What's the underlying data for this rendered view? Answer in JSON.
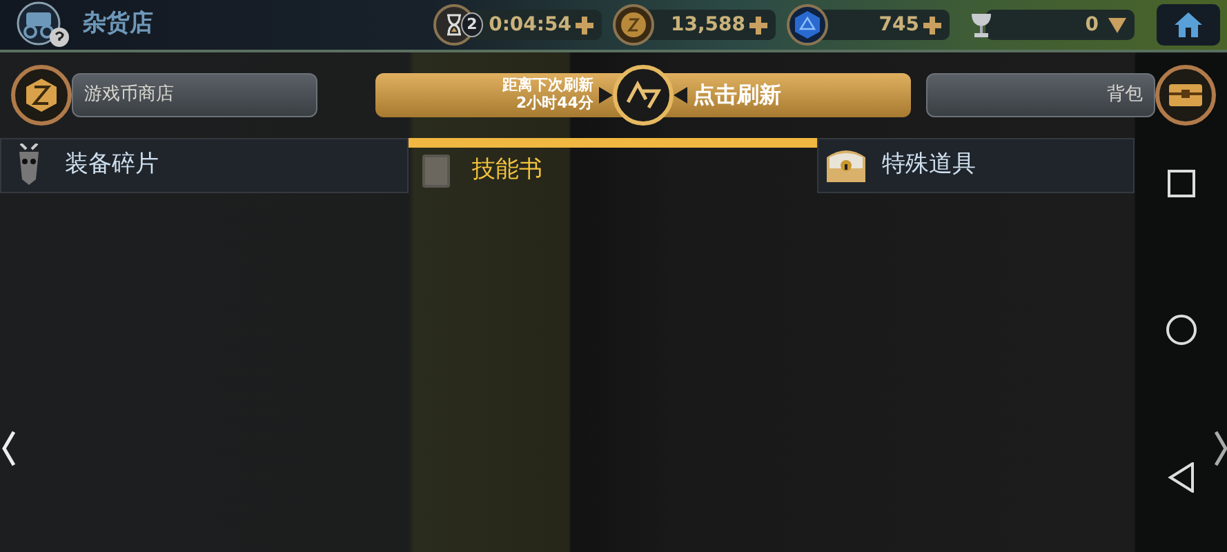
{
  "header": {
    "title": "杂货店"
  },
  "resources": [
    {
      "kind": "hourglass",
      "count": "2",
      "value": "0:04:54",
      "dropdown": false
    },
    {
      "kind": "coin",
      "value": "13,588",
      "dropdown": false
    },
    {
      "kind": "gem",
      "value": "745",
      "dropdown": false
    },
    {
      "kind": "trophy",
      "value": "0",
      "dropdown": true
    }
  ],
  "shop_bar": {
    "left_button": "游戏币商店",
    "refresh": {
      "countdown_label": "距离下次刷新",
      "countdown_time": "2小时44分",
      "action": "点击刷新"
    },
    "right_button": "背包"
  },
  "tabs": [
    {
      "label": "装备碎片",
      "kind": "mask",
      "selected": false
    },
    {
      "label": "技能书",
      "kind": "book",
      "selected": true
    },
    {
      "label": "特殊道具",
      "kind": "chest",
      "selected": false
    }
  ]
}
